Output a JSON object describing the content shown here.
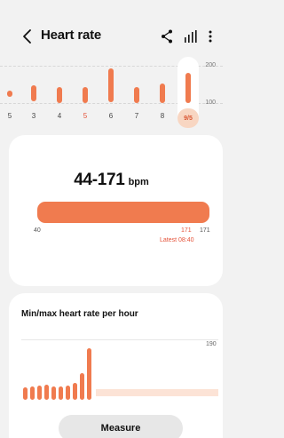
{
  "header": {
    "title": "Heart rate"
  },
  "icons": {
    "back": "chevron-left-icon",
    "share": "share-icon",
    "chart": "bar-chart-icon",
    "more": "more-vertical-icon"
  },
  "daily_strip": {
    "y_top_label": "200",
    "y_mid_label": "100",
    "days": [
      {
        "label": "5",
        "highlight": false
      },
      {
        "label": "3",
        "highlight": false
      },
      {
        "label": "4",
        "highlight": false
      },
      {
        "label": "5",
        "highlight": true
      },
      {
        "label": "6",
        "highlight": false
      },
      {
        "label": "7",
        "highlight": false
      },
      {
        "label": "8",
        "highlight": false
      }
    ],
    "selected_day": "9/5"
  },
  "range_card": {
    "value": "44-171",
    "unit": "bpm",
    "min_label": "40",
    "max_label": "171",
    "marker_label": "171",
    "latest": "Latest 08:40"
  },
  "hourly_card": {
    "title": "Min/max heart rate per hour",
    "y_top_label": "190"
  },
  "measure_button": "Measure",
  "colors": {
    "accent": "#f07b4f",
    "accent_light": "#fce3d6",
    "background": "#f2f2f2",
    "card": "#ffffff"
  }
}
